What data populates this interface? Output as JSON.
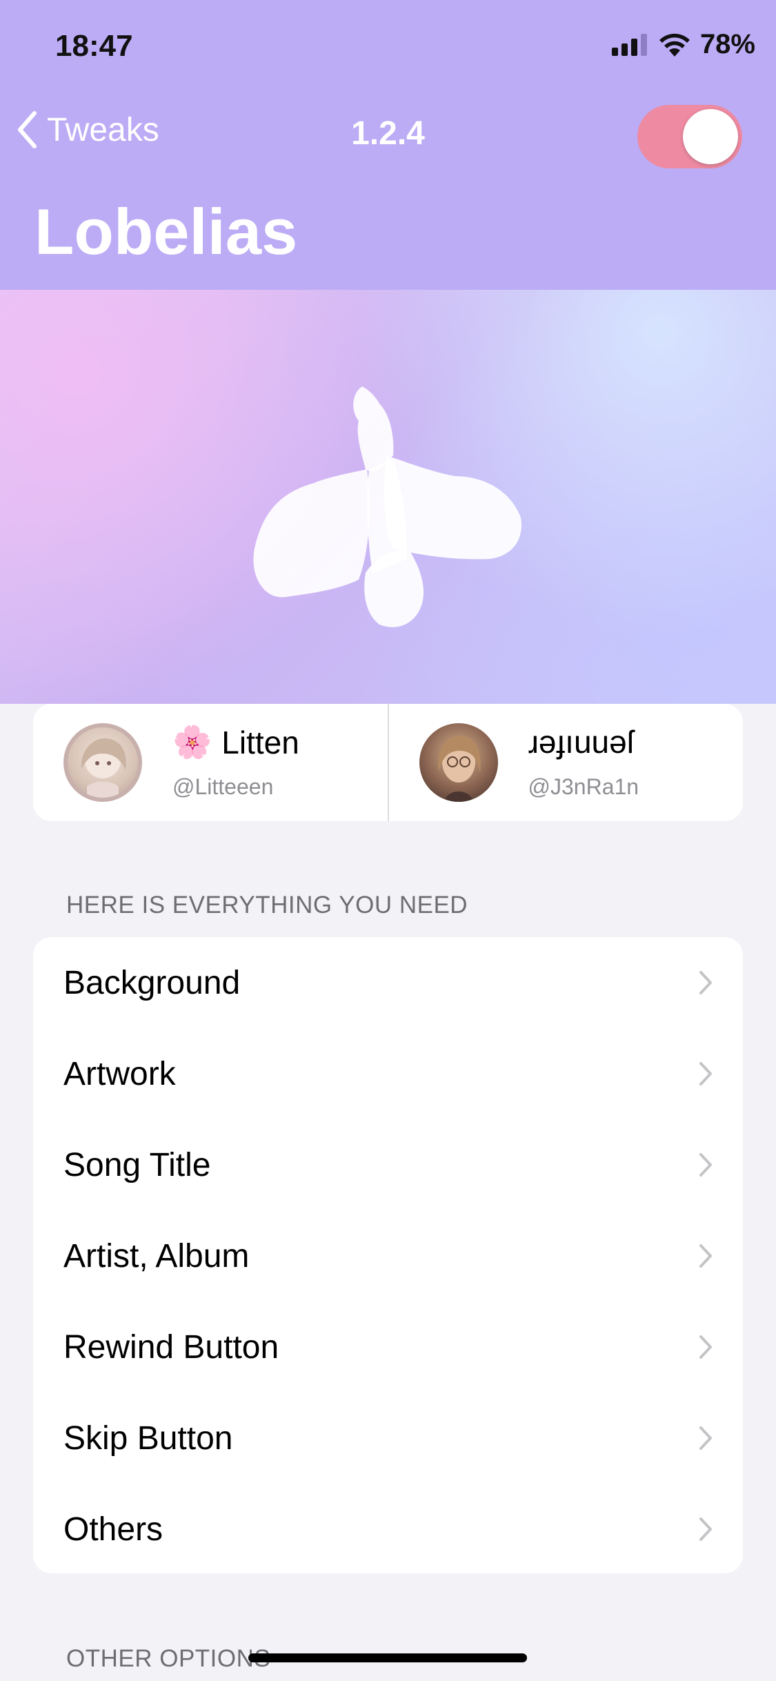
{
  "status_bar": {
    "time": "18:47",
    "battery": "78%"
  },
  "nav": {
    "back_label": "Tweaks",
    "version": "1.2.4",
    "enabled": true
  },
  "title": "Lobelias",
  "credits": [
    {
      "emoji": "🌸",
      "name": "Litten",
      "handle": "@Litteeen"
    },
    {
      "name": "ɹǝɟıuuǝſ",
      "handle": "@J3nRa1n"
    }
  ],
  "sections": [
    {
      "header": "HERE IS EVERYTHING YOU NEED",
      "items": [
        "Background",
        "Artwork",
        "Song Title",
        "Artist, Album",
        "Rewind Button",
        "Skip Button",
        "Others"
      ]
    },
    {
      "header": "OTHER OPTIONS"
    }
  ],
  "colors": {
    "header_bg": "#bcacf5",
    "toggle_on": "#ee8aa1",
    "background": "#f2f2f7"
  }
}
